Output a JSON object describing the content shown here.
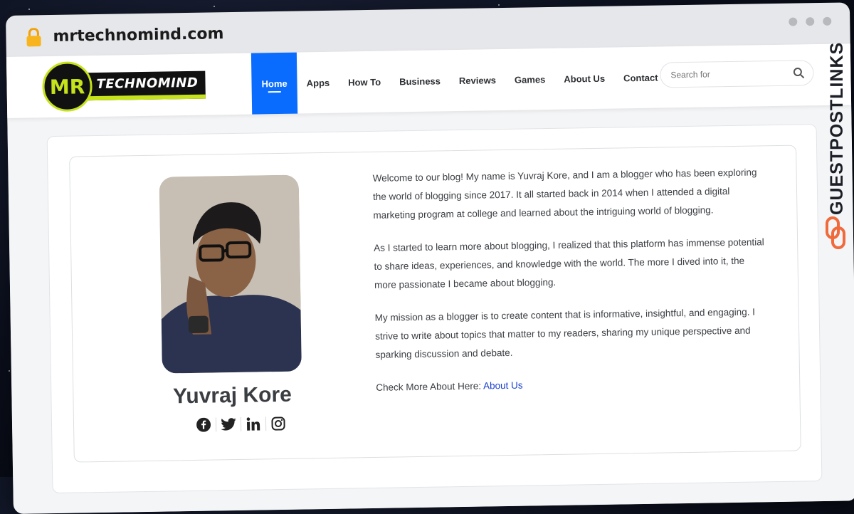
{
  "browser": {
    "url": "mrtechnomind.com"
  },
  "site": {
    "logo": {
      "mark": "MR",
      "wordmark": "TECHNOMIND"
    },
    "nav": [
      {
        "label": "Home",
        "active": true
      },
      {
        "label": "Apps"
      },
      {
        "label": "How To"
      },
      {
        "label": "Business"
      },
      {
        "label": "Reviews"
      },
      {
        "label": "Games"
      },
      {
        "label": "About Us"
      },
      {
        "label": "Contact Us"
      }
    ],
    "search": {
      "placeholder": "Search for"
    }
  },
  "author": {
    "name": "Yuvraj Kore",
    "socials": [
      "facebook-icon",
      "twitter-icon",
      "linkedin-icon",
      "instagram-icon"
    ]
  },
  "bio": {
    "p1": "Welcome to our blog! My name is Yuvraj Kore, and I am a blogger who has been exploring the world of blogging since 2017. It all started back in 2014 when I attended a digital marketing program at college and learned about the intriguing world of blogging.",
    "p2": "As I started to learn more about blogging, I realized that this platform has immense potential to share ideas, experiences, and knowledge with the world. The more I dived into it, the more passionate I became about blogging.",
    "p3": "My mission as a blogger is to create content that is informative, insightful, and engaging. I strive to write about topics that matter to my readers, sharing my unique perspective and sparking discussion and debate.",
    "more_prefix": "Check More About Here: ",
    "more_link": "About Us"
  },
  "watermark": {
    "text": "GUESTPOSTLINKS"
  },
  "colors": {
    "accent": "#0a6cff",
    "logo_green": "#c6e21a",
    "watermark": "#1c1f26",
    "watermark_icon": "#f06a3b"
  }
}
